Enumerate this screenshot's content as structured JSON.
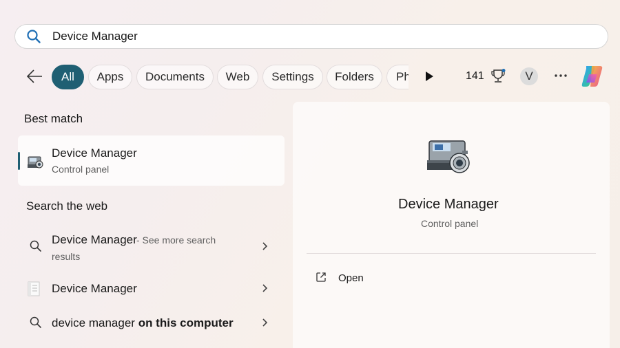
{
  "search": {
    "query": "Device Manager"
  },
  "filters": {
    "tabs": [
      {
        "label": "All",
        "active": true
      },
      {
        "label": "Apps"
      },
      {
        "label": "Documents"
      },
      {
        "label": "Web"
      },
      {
        "label": "Settings"
      },
      {
        "label": "Folders"
      },
      {
        "label": "Ph"
      }
    ],
    "points": "141",
    "avatar_initial": "V"
  },
  "best_match": {
    "heading": "Best match",
    "title": "Device Manager",
    "subtitle": "Control panel"
  },
  "search_web": {
    "heading": "Search the web",
    "items": [
      {
        "main": "Device Manager",
        "suffix": " - See more search",
        "suffix2": "results",
        "icon": "search-icon"
      },
      {
        "main": "Device Manager",
        "icon": "document-icon"
      },
      {
        "main": "device manager",
        "bold": " on this computer",
        "icon": "search-icon"
      }
    ]
  },
  "detail": {
    "title": "Device Manager",
    "subtitle": "Control panel",
    "actions": [
      {
        "label": "Open",
        "icon": "open-external-icon"
      }
    ]
  },
  "colors": {
    "accent": "#1f5f73"
  }
}
